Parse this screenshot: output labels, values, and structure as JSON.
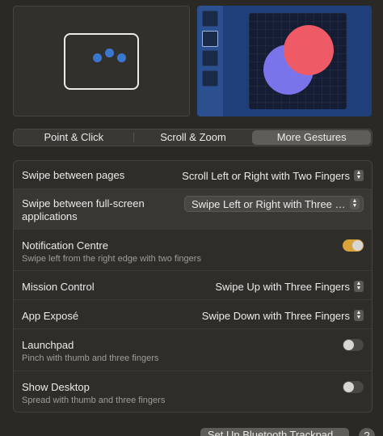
{
  "tabs": [
    {
      "label": "Point & Click",
      "selected": false
    },
    {
      "label": "Scroll & Zoom",
      "selected": false
    },
    {
      "label": "More Gestures",
      "selected": true
    }
  ],
  "rows": [
    {
      "title": "Swipe between pages",
      "value": "Scroll Left or Right with Two Fingers"
    },
    {
      "title": "Swipe between full-screen applications",
      "value": "Swipe Left or Right with Three Fi..."
    },
    {
      "title": "Notification Centre",
      "subtitle": "Swipe left from the right edge with two fingers",
      "toggle": true
    },
    {
      "title": "Mission Control",
      "value": "Swipe Up with Three Fingers"
    },
    {
      "title": "App Exposé",
      "value": "Swipe Down with Three Fingers"
    },
    {
      "title": "Launchpad",
      "subtitle": "Pinch with thumb and three fingers",
      "toggle": false
    },
    {
      "title": "Show Desktop",
      "subtitle": "Spread with thumb and three fingers",
      "toggle": false
    }
  ],
  "footer": {
    "bluetooth_button": "Set Up Bluetooth Trackpad...",
    "help_button": "?"
  },
  "colors": {
    "accent_toggle": "#d9a23a",
    "dot": "#3a78d0",
    "circle_red": "#ee5a66",
    "circle_blue": "#7a74ea"
  }
}
